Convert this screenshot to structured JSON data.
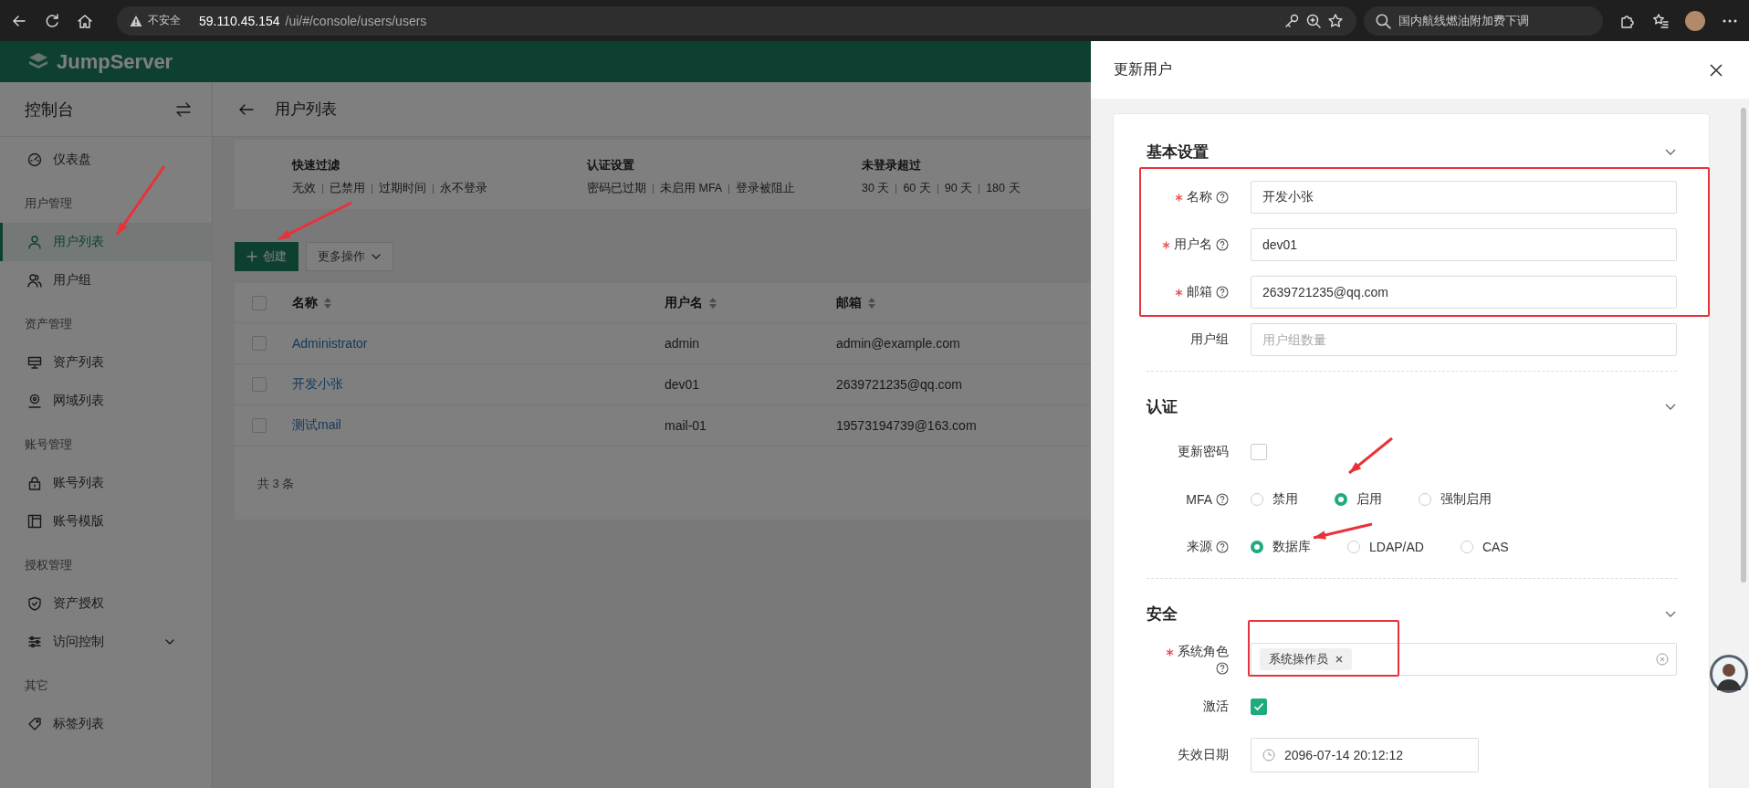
{
  "browser": {
    "security": "不安全",
    "url_host": "59.110.45.154",
    "url_path": "/ui/#/console/users/users",
    "search": "国内航线燃油附加费下调"
  },
  "app": {
    "brand": "JumpServer"
  },
  "sidebar": {
    "title": "控制台",
    "items": [
      {
        "kind": "item",
        "label": "仪表盘",
        "selected": false
      },
      {
        "kind": "heading",
        "label": "用户管理"
      },
      {
        "kind": "item",
        "label": "用户列表",
        "selected": true
      },
      {
        "kind": "item",
        "label": "用户组",
        "selected": false
      },
      {
        "kind": "heading",
        "label": "资产管理"
      },
      {
        "kind": "item",
        "label": "资产列表",
        "selected": false
      },
      {
        "kind": "item",
        "label": "网域列表",
        "selected": false
      },
      {
        "kind": "heading",
        "label": "账号管理"
      },
      {
        "kind": "item",
        "label": "账号列表",
        "selected": false
      },
      {
        "kind": "item",
        "label": "账号模版",
        "selected": false
      },
      {
        "kind": "heading",
        "label": "授权管理"
      },
      {
        "kind": "item",
        "label": "资产授权",
        "selected": false
      },
      {
        "kind": "group",
        "label": "访问控制",
        "selected": false
      },
      {
        "kind": "heading",
        "label": "其它"
      },
      {
        "kind": "item",
        "label": "标签列表",
        "selected": false
      }
    ]
  },
  "page": {
    "title": "用户列表",
    "filters": [
      {
        "title": "快速过滤",
        "options": [
          "无效",
          "已禁用",
          "过期时间",
          "永不登录"
        ]
      },
      {
        "title": "认证设置",
        "options": [
          "密码已过期",
          "未启用 MFA",
          "登录被阻止"
        ]
      },
      {
        "title": "未登录超过",
        "options": [
          "30 天",
          "60 天",
          "90 天",
          "180 天"
        ]
      }
    ],
    "actions": [
      {
        "kind": "primary",
        "label": "创建"
      },
      {
        "kind": "dropdown",
        "label": "更多操作"
      }
    ],
    "table": {
      "columns": [
        "名称",
        "用户名",
        "邮箱"
      ],
      "all_checked": false,
      "rows": [
        {
          "checked": false,
          "cells": [
            "Administrator",
            "admin",
            "admin@example.com"
          ]
        },
        {
          "checked": false,
          "cells": [
            "开发小张",
            "dev01",
            "2639721235@qq.com"
          ]
        },
        {
          "checked": false,
          "cells": [
            "测试mail",
            "mail-01",
            "19573194739@163.com"
          ]
        }
      ]
    },
    "total": "共 3 条"
  },
  "drawer": {
    "title": "更新用户",
    "sections": [
      {
        "title": "基本设置",
        "fields": [
          {
            "kind": "text",
            "label": "名称",
            "required": true,
            "help": true,
            "value": "开发小张"
          },
          {
            "kind": "text",
            "label": "用户名",
            "required": true,
            "help": true,
            "value": "dev01"
          },
          {
            "kind": "text",
            "label": "邮箱",
            "required": true,
            "help": true,
            "value": "2639721235@qq.com"
          },
          {
            "kind": "text",
            "label": "用户组",
            "required": false,
            "help": false,
            "placeholder": "用户组数量"
          }
        ]
      },
      {
        "title": "认证",
        "fields": [
          {
            "kind": "checkbox",
            "label": "更新密码",
            "required": false,
            "help": false,
            "checked": false
          },
          {
            "kind": "radio",
            "label": "MFA",
            "required": false,
            "help": true,
            "options": [
              {
                "label": "禁用",
                "selected": false
              },
              {
                "label": "启用",
                "selected": true
              },
              {
                "label": "强制启用",
                "selected": false
              }
            ]
          },
          {
            "kind": "radio",
            "label": "来源",
            "required": false,
            "help": true,
            "options": [
              {
                "label": "数据库",
                "selected": true
              },
              {
                "label": "LDAP/AD",
                "selected": false
              },
              {
                "label": "CAS",
                "selected": false
              }
            ]
          }
        ]
      },
      {
        "title": "安全",
        "fields": [
          {
            "kind": "tags",
            "label": "系统角色",
            "required": true,
            "help": true,
            "tags": [
              "系统操作员"
            ]
          },
          {
            "kind": "checkbox",
            "label": "激活",
            "required": false,
            "help": false,
            "checked": true
          },
          {
            "kind": "date",
            "label": "失效日期",
            "required": false,
            "help": false,
            "value": "2096-07-14 20:12:12"
          }
        ]
      }
    ]
  }
}
